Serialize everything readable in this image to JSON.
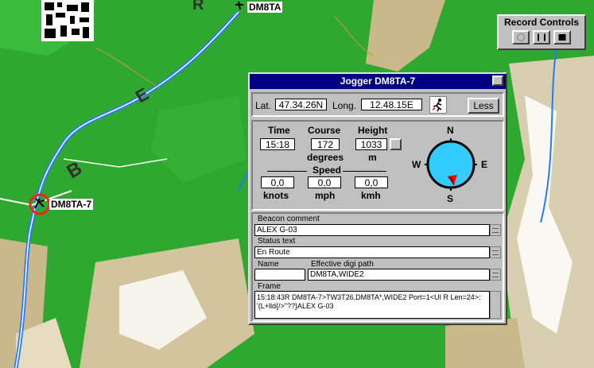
{
  "map": {
    "top_label": "DM8TA",
    "station_label": "DM8TA-7",
    "place_labels": [
      "B",
      "E"
    ]
  },
  "record_controls": {
    "title": "Record Controls",
    "buttons": [
      "record",
      "pause",
      "stop"
    ]
  },
  "window": {
    "title": "Jogger  DM8TA-7",
    "lat_label": "Lat.",
    "lat_value": "47.34.26N",
    "long_label": "Long.",
    "long_value": "12.48.15E",
    "less_button": "Less",
    "time_label": "Time",
    "time_value": "15:18",
    "course_label": "Course",
    "course_value": "172",
    "course_unit": "degrees",
    "height_label": "Height",
    "height_value": "1033",
    "height_unit": "m",
    "speed_label": "Speed",
    "speed": [
      {
        "value": "0,0",
        "unit": "knots"
      },
      {
        "value": "0,0",
        "unit": "mph"
      },
      {
        "value": "0,0",
        "unit": "kmh"
      }
    ],
    "compass": {
      "n": "N",
      "s": "S",
      "e": "E",
      "w": "W",
      "heading_deg": 172
    },
    "beacon_label": "Beacon comment",
    "beacon_value": "ALEX G-03",
    "status_label": "Status text",
    "status_value": "En Route",
    "name_label": "Name",
    "name_value": "",
    "digi_label": "Effective digi path",
    "digi_value": "DM8TA,WIDE2",
    "frame_label": "Frame",
    "frame_line1": "15:18:43R DM8TA-7>TW3T26,DM8TA*,WIDE2 Port=1<UI R Len=24>:",
    "frame_line2": "'(L+lld{/>\"??}ALEX G-03"
  },
  "colors": {
    "titlebar": "#000080",
    "compass_face": "#33ccff",
    "arrow": "#ff0000",
    "map_green": "#2ea82e"
  }
}
